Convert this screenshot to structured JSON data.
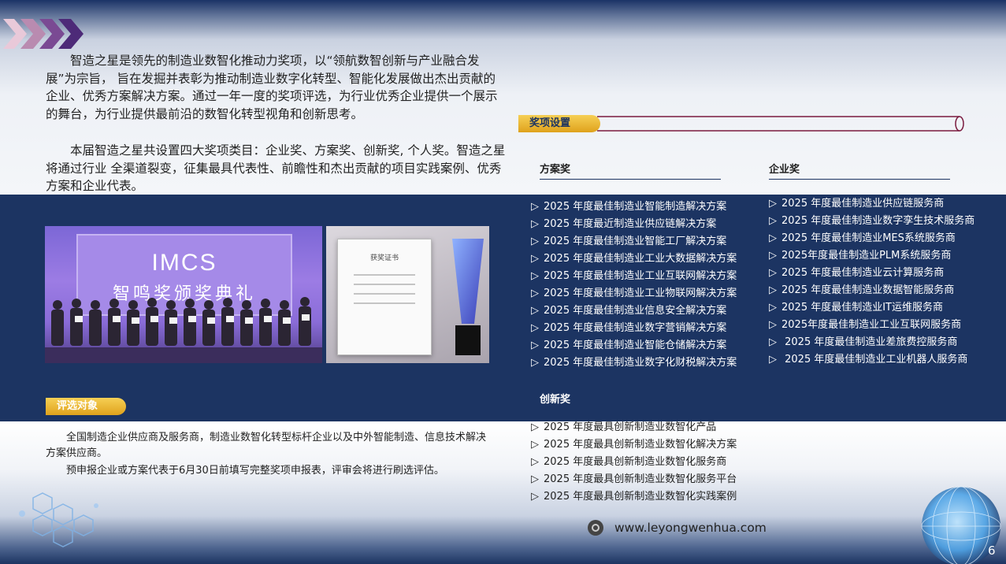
{
  "intro": {
    "p1": "智造之星是领先的制造业数智化推动力奖项，以“领航数智创新与产业融合发展”为宗旨， 旨在发掘并表彰为推动制造业数字化转型、智能化发展做出杰出贡献的企业、优秀方案解决方案。通过一年一度的奖项评选，为行业优秀企业提供一个展示的舞台，为行业提供最前沿的数智化转型视角和创新思考。",
    "p2": "本届智造之星共设置四大奖项类目：企业奖、方案奖、创新奖, 个人奖。智造之星将通过行业  全渠道裂变，征集最具代表性、前瞻性和杰出贡献的项目实践案例、优秀方案和企业代表。"
  },
  "photo": {
    "banner_main": "IMCS",
    "banner_sub": "智鸣奖颁奖典礼",
    "cert_title": "获奖证书"
  },
  "awards": {
    "tag": "奖项设置",
    "scheme": {
      "heading": "方案奖",
      "marker": "▷",
      "items": [
        "2025 年度最佳制造业智能制造解决方案",
        "2025 年度最近制造业供应链解决方案",
        "2025 年度最佳制造业智能工厂解决方案",
        "2025 年度最佳制造业工业大数据解决方案",
        "2025 年度最佳制造业工业互联网解决方案",
        "2025 年度最佳制造业工业物联网解决方案",
        "2025 年度最佳制造业信息安全解决方案",
        "2025 年度最佳制造业数字营销解决方案",
        "2025 年度最佳制造业智能仓储解决方案",
        "2025 年度最佳制造业数字化财税解决方案"
      ]
    },
    "corporate": {
      "heading": "企业奖",
      "marker": "▷",
      "items": [
        "2025 年度最佳制造业供应链服务商",
        "2025 年度最佳制造业数字孪生技术服务商",
        "2025 年度最佳制造业MES系统服务商",
        "2025年度最佳制造业PLM系统服务商",
        "2025 年度最佳制造业云计算服务商",
        "2025 年度最佳制造业数据智能服务商",
        "2025 年度最佳制造业IT运维服务商",
        "2025年度最佳制造业工业互联网服务商",
        " 2025 年度最佳制造业差旅费控服务商",
        " 2025 年度最佳制造业工业机器人服务商"
      ]
    },
    "innovation": {
      "heading": "创新奖",
      "marker": "▷",
      "items": [
        "2025 年度最具创新制造业数智化产品",
        "2025 年度最具创新制造业数智化解决方案",
        "2025 年度最具创新制造业数智化服务商",
        "2025 年度最具创新制造业数智化服务平台",
        "2025 年度最具创新制造业数智化实践案例"
      ]
    }
  },
  "evaluation": {
    "tag": "评选对象",
    "p1": "全国制造企业供应商及服务商，制造业数智化转型标杆企业以及中外智能制造、信息技术解决方案供应商。",
    "p2": "预申报企业或方案代表于6月30日前填写完整奖项申报表，评审会将进行刷选评估。"
  },
  "footer": {
    "url": "www.leyongwenhua.com",
    "page_number": "6"
  },
  "colors": {
    "navy": "#1c3462",
    "gold": "#e8b42c",
    "purple": "#5a2d82"
  },
  "icons": {
    "chevrons": "chevron-arrows-icon",
    "site_logo": "web-logo-icon",
    "globe": "globe-network-icon",
    "tech": "tech-hexagon-icon"
  }
}
